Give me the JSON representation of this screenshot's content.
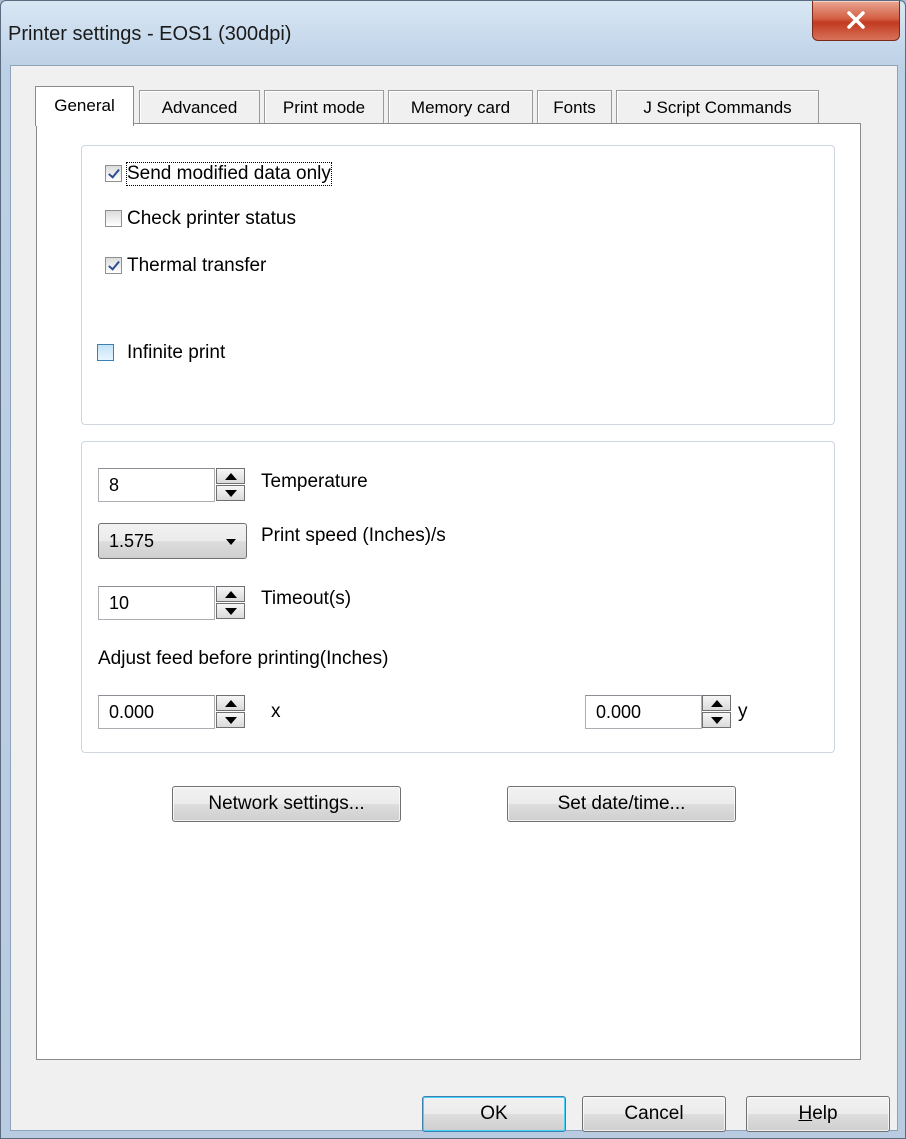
{
  "window": {
    "title": "Printer settings - EOS1 (300dpi)"
  },
  "tabs": [
    {
      "label": "General",
      "active": true
    },
    {
      "label": "Advanced"
    },
    {
      "label": "Print mode"
    },
    {
      "label": "Memory card"
    },
    {
      "label": "Fonts"
    },
    {
      "label": "J Script Commands"
    }
  ],
  "options": {
    "send_modified": {
      "label": "Send modified data only",
      "checked": true
    },
    "check_status": {
      "label": "Check printer status",
      "checked": false
    },
    "thermal_transfer": {
      "label": "Thermal transfer",
      "checked": true
    },
    "infinite_print": {
      "label": "Infinite print",
      "checked": false
    }
  },
  "settings": {
    "temperature": {
      "value": "8",
      "label": "Temperature"
    },
    "print_speed": {
      "value": "1.575",
      "label": "Print speed (Inches)/s"
    },
    "timeout": {
      "value": "10",
      "label": "Timeout(s)"
    },
    "adjust_feed_label": "Adjust feed before printing(Inches)",
    "feed_x": {
      "value": "0.000",
      "label": "x"
    },
    "feed_y": {
      "value": "0.000",
      "label": "y"
    }
  },
  "buttons": {
    "network": "Network settings...",
    "datetime": "Set date/time...",
    "ok": "OK",
    "cancel": "Cancel",
    "help_first": "H",
    "help_rest": "elp"
  },
  "colors": {
    "close_button": "#c13a1f",
    "default_button_border": "#3c7fb1",
    "checkmark": "#2b4f8f"
  }
}
